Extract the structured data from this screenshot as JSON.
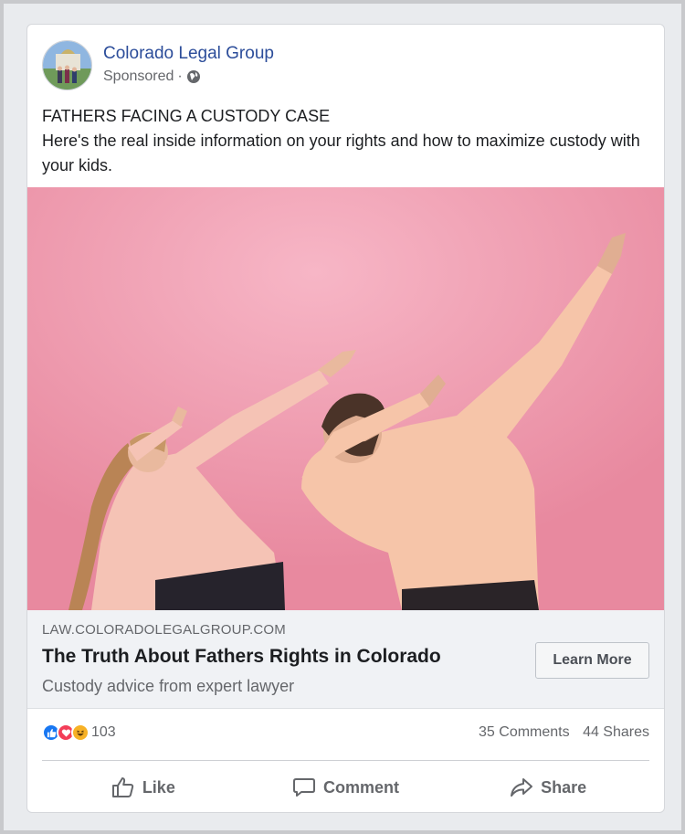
{
  "post": {
    "page_name": "Colorado Legal Group",
    "sponsored": "Sponsored",
    "separator": "·",
    "privacy_icon": "globe-icon",
    "text_line1": "FATHERS FACING A CUSTODY CASE",
    "text_line2": "Here's the real inside information on your rights and how to maximize custody with your kids."
  },
  "link": {
    "domain": "LAW.COLORADOLEGALGROUP.COM",
    "headline": "The Truth About Fathers Rights in Colorado",
    "description": "Custody advice from expert lawyer",
    "cta_label": "Learn More"
  },
  "engagement": {
    "reaction_icons": [
      "like-icon",
      "love-icon",
      "haha-icon"
    ],
    "reaction_count": "103",
    "comments": "35 Comments",
    "shares": "44 Shares"
  },
  "actions": {
    "like_label": "Like",
    "comment_label": "Comment",
    "share_label": "Share"
  },
  "colors": {
    "brand_link": "#2c4d9a",
    "like_blue": "#1877f2",
    "love_red": "#f33e58",
    "haha_yellow": "#f7b125",
    "background_pink": "#ef9bb0"
  }
}
